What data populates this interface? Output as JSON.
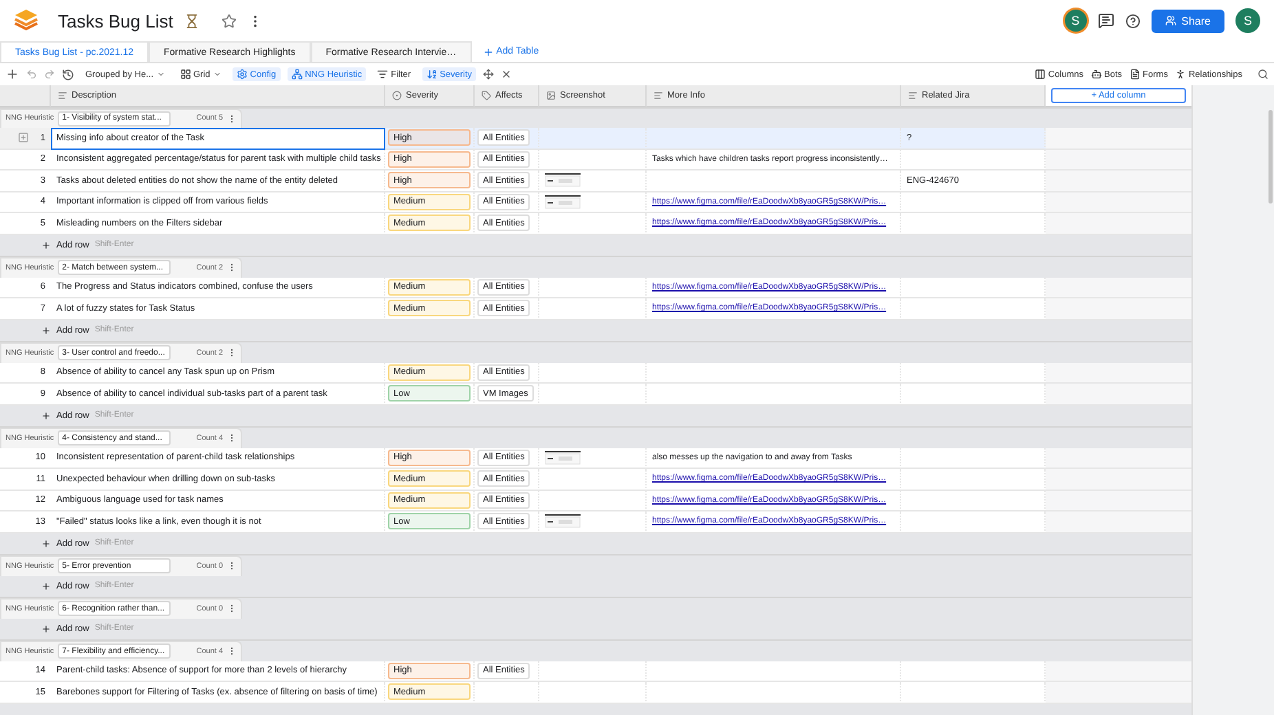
{
  "app": {
    "title": "Tasks Bug List"
  },
  "header_right": {
    "avatar": "S",
    "share": "Share",
    "account": "S"
  },
  "tabs": [
    {
      "label": "Tasks Bug List - pc.2021.12",
      "selected": true
    },
    {
      "label": "Formative Research Highlights",
      "selected": false
    },
    {
      "label": "Formative Research Intervie…",
      "selected": false
    }
  ],
  "add_table": "Add Table",
  "toolbar": {
    "items": [
      {
        "kind": "dropdown",
        "label": "Grouped by He...",
        "active": false
      },
      {
        "kind": "grid",
        "label": "Grid",
        "active": false
      },
      {
        "kind": "config",
        "label": "Config",
        "active": true
      },
      {
        "kind": "group",
        "label": "NNG Heuristic",
        "active": true
      },
      {
        "kind": "filter",
        "label": "Filter",
        "active": false
      },
      {
        "kind": "sort",
        "label": "Severity",
        "active": true
      }
    ],
    "right": [
      {
        "kind": "columns",
        "label": "Columns"
      },
      {
        "kind": "bots",
        "label": "Bots"
      },
      {
        "kind": "forms",
        "label": "Forms"
      },
      {
        "kind": "relationships",
        "label": "Relationships"
      }
    ]
  },
  "columns": [
    {
      "kind": "text",
      "label": "Description"
    },
    {
      "kind": "select",
      "label": "Severity"
    },
    {
      "kind": "tag",
      "label": "Affects"
    },
    {
      "kind": "image",
      "label": "Screenshot"
    },
    {
      "kind": "text",
      "label": "More Info"
    },
    {
      "kind": "text",
      "label": "Related Jira"
    }
  ],
  "add_column": "+ Add column",
  "groups": [
    {
      "label": "NNG Heuristic",
      "title": "1- Visibility of system stat...",
      "count": "Count 5",
      "add_row": {
        "label": "Add row",
        "hint": "Shift-Enter"
      },
      "rows": [
        {
          "number": "1",
          "selected": true,
          "description": "Missing info about creator of the Task",
          "severity": {
            "label": "High",
            "color": "#f6b98e"
          },
          "affects": "All Entities",
          "screenshot": false,
          "related_jira": "?"
        },
        {
          "number": "2",
          "selected": false,
          "description": "Inconsistent aggregated percentage/status for parent task with multiple child tasks",
          "severity": {
            "label": "High",
            "color": "#f6b98e"
          },
          "affects": "All Entities",
          "screenshot": false,
          "more_info": {
            "kind": "text",
            "text": "Tasks which have children tasks report progress inconsistently…"
          }
        },
        {
          "number": "3",
          "selected": false,
          "description": "Tasks about deleted entities do not show the name of the entity deleted",
          "severity": {
            "label": "High",
            "color": "#f6b98e"
          },
          "affects": "All Entities",
          "screenshot": true,
          "related_jira": "ENG-424670"
        },
        {
          "number": "4",
          "selected": false,
          "description": "Important information is clipped off from various fields",
          "severity": {
            "label": "Medium",
            "color": "#f9d77e"
          },
          "affects": "All Entities",
          "screenshot": true,
          "more_info": {
            "kind": "link",
            "text": "https://www.figma.com/file/rEaDoodwXb8yaoGR5gS8KW/Pris…"
          }
        },
        {
          "number": "5",
          "selected": false,
          "description": "Misleading numbers on the Filters sidebar",
          "severity": {
            "label": "Medium",
            "color": "#f9d77e"
          },
          "affects": "All Entities",
          "screenshot": false,
          "more_info": {
            "kind": "link",
            "text": "https://www.figma.com/file/rEaDoodwXb8yaoGR5gS8KW/Pris…"
          }
        }
      ]
    },
    {
      "label": "NNG Heuristic",
      "title": "2- Match between system...",
      "count": "Count 2",
      "add_row": {
        "label": "Add row",
        "hint": "Shift-Enter"
      },
      "rows": [
        {
          "number": "6",
          "selected": false,
          "description": "The Progress and Status indicators combined, confuse the users",
          "severity": {
            "label": "Medium",
            "color": "#f9d77e"
          },
          "affects": "All Entities",
          "screenshot": false,
          "more_info": {
            "kind": "link",
            "text": "https://www.figma.com/file/rEaDoodwXb8yaoGR5gS8KW/Pris…"
          }
        },
        {
          "number": "7",
          "selected": false,
          "description": "A lot of fuzzy states for Task Status",
          "severity": {
            "label": "Medium",
            "color": "#f9d77e"
          },
          "affects": "All Entities",
          "screenshot": false,
          "more_info": {
            "kind": "link",
            "text": "https://www.figma.com/file/rEaDoodwXb8yaoGR5gS8KW/Pris…"
          }
        }
      ]
    },
    {
      "label": "NNG Heuristic",
      "title": "3- User control and freedo...",
      "count": "Count 2",
      "add_row": {
        "label": "Add row",
        "hint": "Shift-Enter"
      },
      "rows": [
        {
          "number": "8",
          "selected": false,
          "description": "Absence of ability to cancel any Task spun up on Prism",
          "severity": {
            "label": "Medium",
            "color": "#f9d77e"
          },
          "affects": "All Entities",
          "screenshot": false
        },
        {
          "number": "9",
          "selected": false,
          "description": "Absence of ability to cancel individual sub-tasks part of a parent task",
          "severity": {
            "label": "Low",
            "color": "#9fd3a8"
          },
          "affects": "VM Images",
          "screenshot": false
        }
      ]
    },
    {
      "label": "NNG Heuristic",
      "title": "4- Consistency and stand...",
      "count": "Count 4",
      "add_row": {
        "label": "Add row",
        "hint": "Shift-Enter"
      },
      "rows": [
        {
          "number": "10",
          "selected": false,
          "description": "Inconsistent representation of parent-child task relationships",
          "severity": {
            "label": "High",
            "color": "#f6b98e"
          },
          "affects": "All Entities",
          "screenshot": true,
          "more_info": {
            "kind": "text",
            "text": "also messes up the navigation to and away from Tasks"
          }
        },
        {
          "number": "11",
          "selected": false,
          "description": "Unexpected behaviour when drilling down on sub-tasks",
          "severity": {
            "label": "Medium",
            "color": "#f9d77e"
          },
          "affects": "All Entities",
          "screenshot": false,
          "more_info": {
            "kind": "link",
            "text": "https://www.figma.com/file/rEaDoodwXb8yaoGR5gS8KW/Pris…"
          }
        },
        {
          "number": "12",
          "selected": false,
          "description": "Ambiguous language used for task names",
          "severity": {
            "label": "Medium",
            "color": "#f9d77e"
          },
          "affects": "All Entities",
          "screenshot": false,
          "more_info": {
            "kind": "link",
            "text": "https://www.figma.com/file/rEaDoodwXb8yaoGR5gS8KW/Pris…"
          }
        },
        {
          "number": "13",
          "selected": false,
          "description": "\"Failed\" status looks like a link, even though it is not",
          "severity": {
            "label": "Low",
            "color": "#9fd3a8"
          },
          "affects": "All Entities",
          "screenshot": true,
          "more_info": {
            "kind": "link",
            "text": "https://www.figma.com/file/rEaDoodwXb8yaoGR5gS8KW/Pris…"
          }
        }
      ]
    },
    {
      "label": "NNG Heuristic",
      "title": "5- Error prevention",
      "count": "Count 0",
      "add_row": {
        "label": "Add row",
        "hint": "Shift-Enter"
      }
    },
    {
      "label": "NNG Heuristic",
      "title": "6- Recognition rather than...",
      "count": "Count 0",
      "add_row": {
        "label": "Add row",
        "hint": "Shift-Enter"
      }
    },
    {
      "label": "NNG Heuristic",
      "title": "7- Flexibility and efficiency...",
      "count": "Count 4",
      "rows": [
        {
          "number": "14",
          "selected": false,
          "description": "Parent-child tasks: Absence of support for more than 2 levels of hierarchy",
          "severity": {
            "label": "High",
            "color": "#f6b98e"
          },
          "affects": "All Entities",
          "screenshot": false
        },
        {
          "number": "15",
          "selected": false,
          "description": "Barebones support for Filtering of Tasks (ex. absence of filtering on basis of time)",
          "severity": {
            "label": "Medium",
            "color": "#f9d77e"
          },
          "screenshot": false
        }
      ]
    }
  ]
}
